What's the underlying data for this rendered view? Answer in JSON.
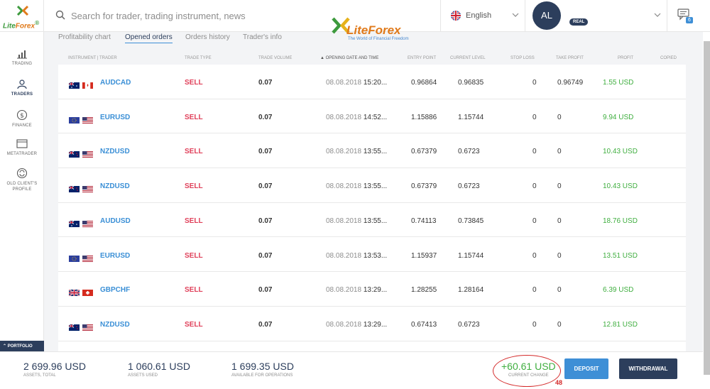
{
  "topbar": {
    "logo": {
      "text_lite": "Lite",
      "text_forex": "Forex"
    },
    "search_placeholder": "Search for trader, trading instrument, news",
    "language": "English",
    "avatar_initials": "AL",
    "account_type": "REAL",
    "notifications_count": "6"
  },
  "brand": {
    "name": "LiteForex",
    "tagline": "The World of Financial Freedom"
  },
  "sidebar": {
    "items": [
      {
        "label": "TRADING",
        "icon": "chart-icon"
      },
      {
        "label": "TRADERS",
        "icon": "traders-icon"
      },
      {
        "label": "FINANCE",
        "icon": "dollar-icon"
      },
      {
        "label": "METATRADER",
        "icon": "monitor-icon"
      },
      {
        "label": "OLD CLIENT'S PROFILE",
        "icon": "refresh-icon"
      }
    ]
  },
  "tabs": [
    "Profitability chart",
    "Opened orders",
    "Orders history",
    "Trader's info"
  ],
  "table": {
    "headers": [
      "INSTRUMENT | TRADER",
      "TRADE TYPE",
      "TRADE VOLUME",
      "▲ OPENING DATE AND TIME",
      "ENTRY POINT",
      "CURRENT LEVEL",
      "STOP LOSS",
      "TAKE PROFIT",
      "PROFIT",
      "COPIED"
    ],
    "rows": [
      {
        "flags": [
          "au",
          "ca"
        ],
        "instrument": "AUDCAD",
        "type": "SELL",
        "volume": "0.07",
        "date": "08.08.2018",
        "time": "15:20...",
        "entry": "0.96864",
        "current": "0.96835",
        "sl": "0",
        "tp": "0.96749",
        "profit": "1.55 USD"
      },
      {
        "flags": [
          "eu",
          "us"
        ],
        "instrument": "EURUSD",
        "type": "SELL",
        "volume": "0.07",
        "date": "08.08.2018",
        "time": "14:52...",
        "entry": "1.15886",
        "current": "1.15744",
        "sl": "0",
        "tp": "0",
        "profit": "9.94 USD"
      },
      {
        "flags": [
          "nz",
          "us"
        ],
        "instrument": "NZDUSD",
        "type": "SELL",
        "volume": "0.07",
        "date": "08.08.2018",
        "time": "13:55...",
        "entry": "0.67379",
        "current": "0.6723",
        "sl": "0",
        "tp": "0",
        "profit": "10.43 USD"
      },
      {
        "flags": [
          "nz",
          "us"
        ],
        "instrument": "NZDUSD",
        "type": "SELL",
        "volume": "0.07",
        "date": "08.08.2018",
        "time": "13:55...",
        "entry": "0.67379",
        "current": "0.6723",
        "sl": "0",
        "tp": "0",
        "profit": "10.43 USD"
      },
      {
        "flags": [
          "au",
          "us"
        ],
        "instrument": "AUDUSD",
        "type": "SELL",
        "volume": "0.07",
        "date": "08.08.2018",
        "time": "13:55...",
        "entry": "0.74113",
        "current": "0.73845",
        "sl": "0",
        "tp": "0",
        "profit": "18.76 USD"
      },
      {
        "flags": [
          "eu",
          "us"
        ],
        "instrument": "EURUSD",
        "type": "SELL",
        "volume": "0.07",
        "date": "08.08.2018",
        "time": "13:53...",
        "entry": "1.15937",
        "current": "1.15744",
        "sl": "0",
        "tp": "0",
        "profit": "13.51 USD"
      },
      {
        "flags": [
          "gb",
          "ch"
        ],
        "instrument": "GBPCHF",
        "type": "SELL",
        "volume": "0.07",
        "date": "08.08.2018",
        "time": "13:29...",
        "entry": "1.28255",
        "current": "1.28164",
        "sl": "0",
        "tp": "0",
        "profit": "6.39 USD"
      },
      {
        "flags": [
          "nz",
          "us"
        ],
        "instrument": "NZDUSD",
        "type": "SELL",
        "volume": "0.07",
        "date": "08.08.2018",
        "time": "13:29...",
        "entry": "0.67413",
        "current": "0.6723",
        "sl": "0",
        "tp": "0",
        "profit": "12.81 USD"
      }
    ]
  },
  "portfolio_label": "PORTFOLIO",
  "footer": {
    "assets_total": {
      "value": "2 699.96 USD",
      "label": "ASSETS, TOTAL"
    },
    "assets_used": {
      "value": "1 060.61 USD",
      "label": "ASSETS USED"
    },
    "available": {
      "value": "1 699.35 USD",
      "label": "AVAILABLE FOR OPERATIONS"
    },
    "current_change": {
      "value": "+60.61 USD",
      "label": "CURRENT CHANGE"
    },
    "annotation_number": "48",
    "deposit_label": "DEPOSIT",
    "withdrawal_label": "WITHDRAWAL"
  },
  "colors": {
    "navy": "#2c3e5c",
    "blue": "#3e8fd6",
    "sell_red": "#e0405a",
    "profit_green": "#3fae3f",
    "annotation_red": "#d42a2a"
  }
}
